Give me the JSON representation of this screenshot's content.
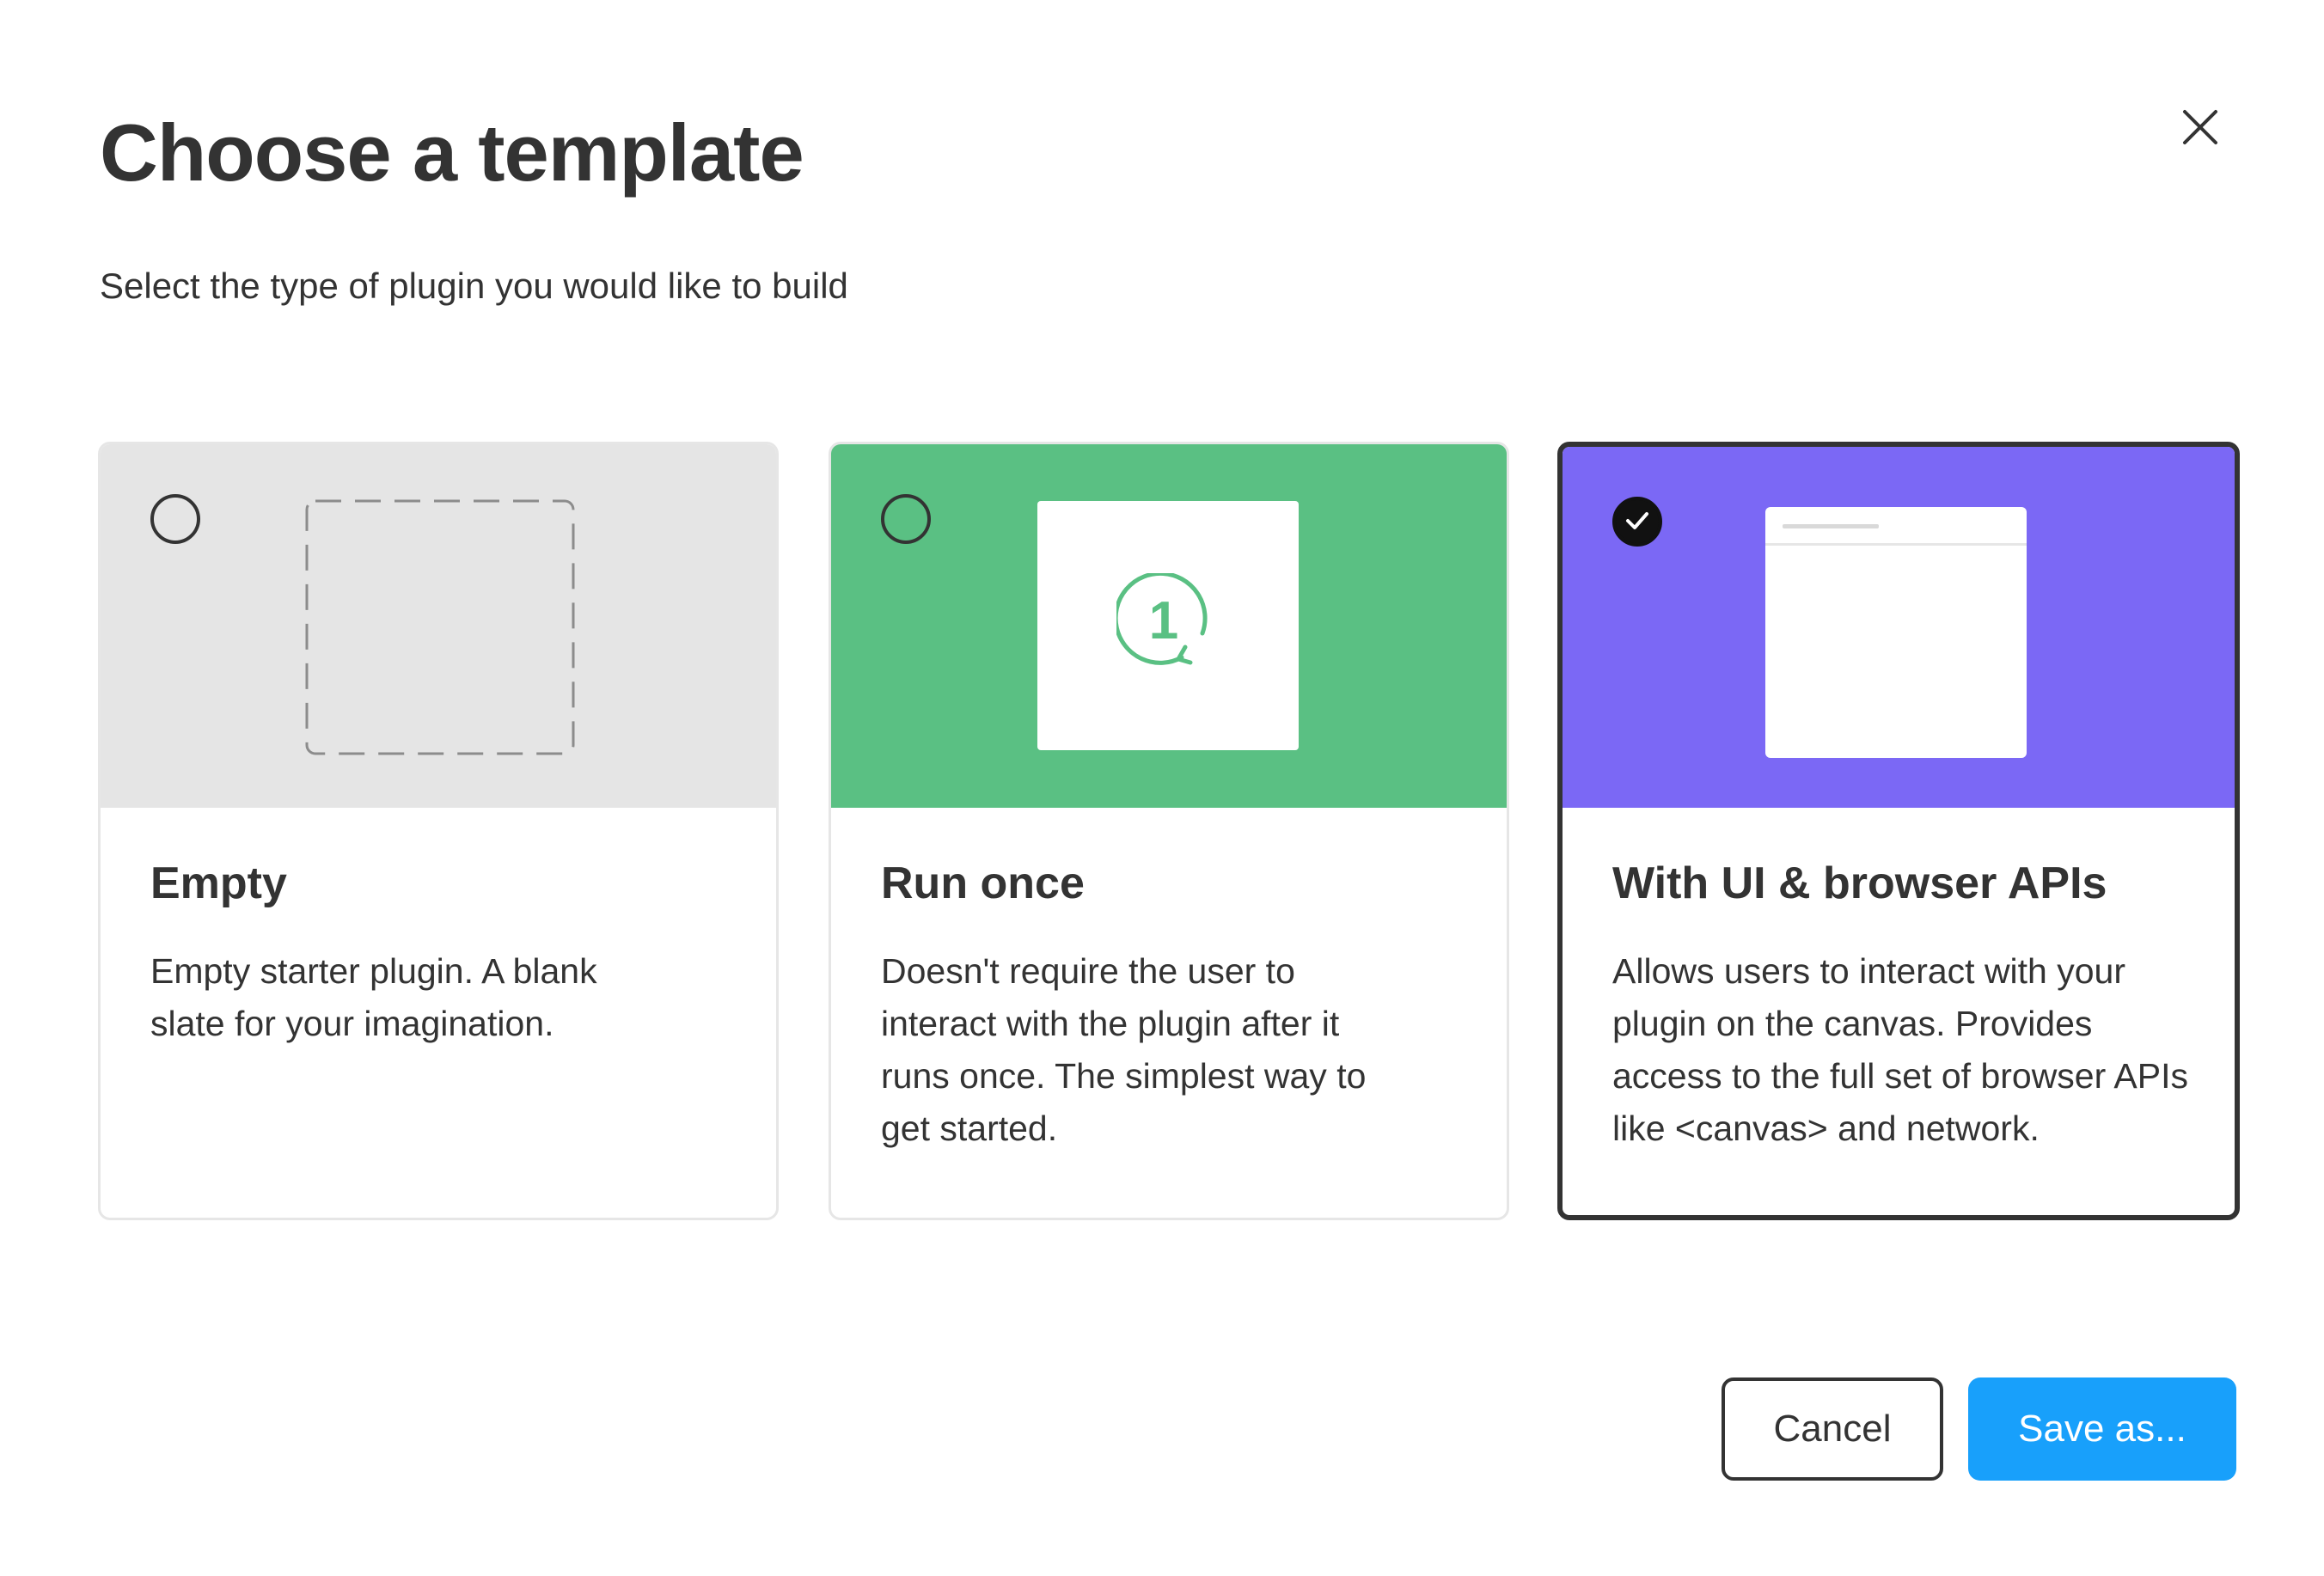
{
  "dialog": {
    "title": "Choose a template",
    "subtitle": "Select the type of plugin you would like to build",
    "close_icon": "close-icon"
  },
  "templates": [
    {
      "title": "Empty",
      "description": "Empty starter plugin. A blank slate for your imagination.",
      "selected": false,
      "preview_color": "#e5e5e5",
      "preview_icon": "dashed-frame-icon"
    },
    {
      "title": "Run once",
      "description": "Doesn't require the user to interact with the plugin after it runs once. The simplest way to get started.",
      "selected": false,
      "preview_color": "#5ac083",
      "preview_icon": "run-once-icon",
      "preview_glyph": "1"
    },
    {
      "title": "With UI & browser APIs",
      "description": "Allows users to interact with your plugin on the canvas. Provides access to the full set of browser APIs like <canvas> and network.",
      "selected": true,
      "preview_color": "#7b68f5",
      "preview_icon": "browser-window-icon"
    }
  ],
  "footer": {
    "cancel_label": "Cancel",
    "save_label": "Save as..."
  },
  "colors": {
    "primary": "#18a0fb",
    "text": "#333333",
    "selected_border": "#333333"
  }
}
